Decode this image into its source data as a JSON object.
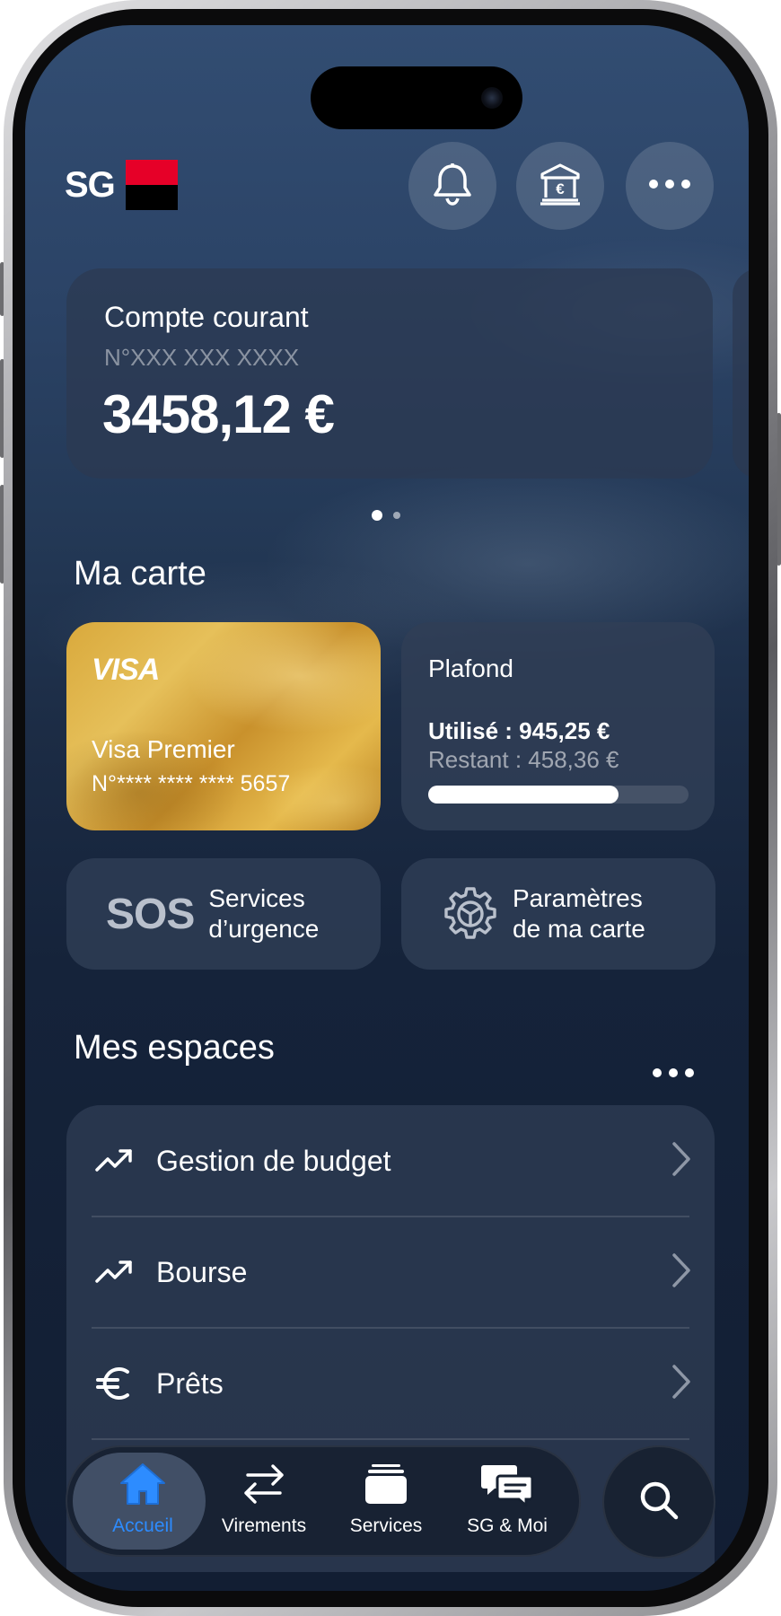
{
  "brand": {
    "logo_text": "SG",
    "colors": {
      "red": "#e60028",
      "black": "#000000",
      "accent": "#2d8cff"
    }
  },
  "header": {
    "buttons": [
      "bell-icon",
      "bank-euro-icon",
      "more-icon"
    ]
  },
  "account": {
    "title": "Compte courant",
    "number": "N°XXX XXX XXXX",
    "balance": "3458,12 €",
    "pager": {
      "count": 2,
      "active": 0
    }
  },
  "card_section": {
    "title": "Ma carte",
    "card": {
      "network": "VISA",
      "name": "Visa Premier",
      "number": "N°**** **** **** 5657"
    },
    "limit": {
      "title": "Plafond",
      "used": "Utilisé : 945,25 €",
      "remaining": "Restant : 458,36 €",
      "used_fraction": 0.73
    },
    "actions": [
      {
        "icon_text": "SOS",
        "line1": "Services",
        "line2": "d’urgence"
      },
      {
        "icon": "gear-icon",
        "line1": "Paramètres",
        "line2": "de ma carte"
      }
    ]
  },
  "spaces": {
    "title": "Mes espaces",
    "items": [
      {
        "icon": "trend-up-icon",
        "label": "Gestion de budget"
      },
      {
        "icon": "trend-up-icon",
        "label": "Bourse"
      },
      {
        "icon": "euro-icon",
        "label": "Prêts"
      }
    ]
  },
  "tabbar": {
    "tabs": [
      {
        "label": "Accueil",
        "icon": "home-icon",
        "active": true
      },
      {
        "label": "Virements",
        "icon": "transfer-icon"
      },
      {
        "label": "Services",
        "icon": "services-icon"
      },
      {
        "label": "SG & Moi",
        "icon": "chat-icon"
      }
    ],
    "search_icon": "search-icon"
  }
}
